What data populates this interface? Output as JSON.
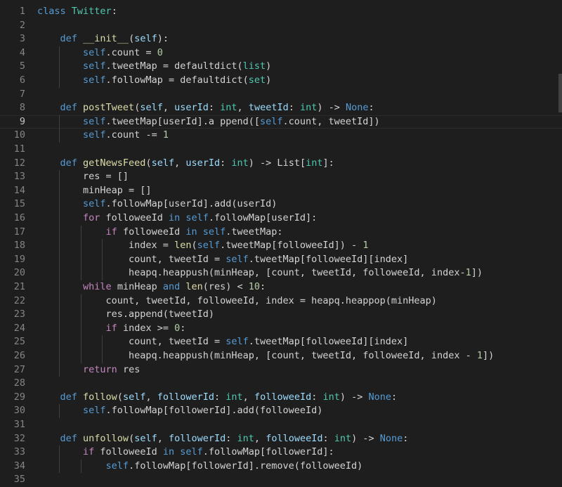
{
  "editor": {
    "colors": {
      "background": "#1e1e1e",
      "line_number": "#858585",
      "keyword": "#569cd6",
      "control": "#c586c0",
      "class": "#4ec9b0",
      "function": "#dcdcaa",
      "param": "#9cdcfe",
      "number": "#b5cea8",
      "text": "#d4d4d4"
    },
    "current_line": 9,
    "lines": [
      [
        [
          "class ",
          "kw"
        ],
        [
          "Twitter",
          "cls"
        ],
        [
          ":",
          "plain"
        ]
      ],
      [],
      [
        [
          "    ",
          "plain"
        ],
        [
          "def ",
          "kw"
        ],
        [
          "__init__",
          "fn"
        ],
        [
          "(",
          "plain"
        ],
        [
          "self",
          "param"
        ],
        [
          "):",
          "plain"
        ]
      ],
      [
        [
          "        ",
          "plain"
        ],
        [
          "self",
          "self"
        ],
        [
          ".count = ",
          "plain"
        ],
        [
          "0",
          "num"
        ]
      ],
      [
        [
          "        ",
          "plain"
        ],
        [
          "self",
          "self"
        ],
        [
          ".tweetMap = defaultdict(",
          "plain"
        ],
        [
          "list",
          "type"
        ],
        [
          ")",
          "plain"
        ]
      ],
      [
        [
          "        ",
          "plain"
        ],
        [
          "self",
          "self"
        ],
        [
          ".followMap = defaultdict(",
          "plain"
        ],
        [
          "set",
          "type"
        ],
        [
          ")",
          "plain"
        ]
      ],
      [],
      [
        [
          "    ",
          "plain"
        ],
        [
          "def ",
          "kw"
        ],
        [
          "postTweet",
          "fn"
        ],
        [
          "(",
          "plain"
        ],
        [
          "self",
          "param"
        ],
        [
          ", ",
          "plain"
        ],
        [
          "userId",
          "param"
        ],
        [
          ": ",
          "plain"
        ],
        [
          "int",
          "type"
        ],
        [
          ", ",
          "plain"
        ],
        [
          "tweetId",
          "param"
        ],
        [
          ": ",
          "plain"
        ],
        [
          "int",
          "type"
        ],
        [
          ") -> ",
          "plain"
        ],
        [
          "None",
          "none"
        ],
        [
          ":",
          "plain"
        ]
      ],
      [
        [
          "        ",
          "plain"
        ],
        [
          "self",
          "self"
        ],
        [
          ".tweetMap[userId].a ppend([",
          "plain"
        ],
        [
          "self",
          "self"
        ],
        [
          ".count, tweetId])",
          "plain"
        ]
      ],
      [
        [
          "        ",
          "plain"
        ],
        [
          "self",
          "self"
        ],
        [
          ".count -= ",
          "plain"
        ],
        [
          "1",
          "num"
        ]
      ],
      [],
      [
        [
          "    ",
          "plain"
        ],
        [
          "def ",
          "kw"
        ],
        [
          "getNewsFeed",
          "fn"
        ],
        [
          "(",
          "plain"
        ],
        [
          "self",
          "param"
        ],
        [
          ", ",
          "plain"
        ],
        [
          "userId",
          "param"
        ],
        [
          ": ",
          "plain"
        ],
        [
          "int",
          "type"
        ],
        [
          ") -> List[",
          "plain"
        ],
        [
          "int",
          "type"
        ],
        [
          "]:",
          "plain"
        ]
      ],
      [
        [
          "        res = []",
          "plain"
        ]
      ],
      [
        [
          "        minHeap = []",
          "plain"
        ]
      ],
      [
        [
          "        ",
          "plain"
        ],
        [
          "self",
          "self"
        ],
        [
          ".followMap[userId].add(userId)",
          "plain"
        ]
      ],
      [
        [
          "        ",
          "plain"
        ],
        [
          "for ",
          "ctrl"
        ],
        [
          "followeeId ",
          "plain"
        ],
        [
          "in ",
          "kw"
        ],
        [
          "self",
          "self"
        ],
        [
          ".followMap[userId]:",
          "plain"
        ]
      ],
      [
        [
          "            ",
          "plain"
        ],
        [
          "if ",
          "ctrl"
        ],
        [
          "followeeId ",
          "plain"
        ],
        [
          "in ",
          "kw"
        ],
        [
          "self",
          "self"
        ],
        [
          ".tweetMap:",
          "plain"
        ]
      ],
      [
        [
          "                index = ",
          "plain"
        ],
        [
          "len",
          "fn"
        ],
        [
          "(",
          "plain"
        ],
        [
          "self",
          "self"
        ],
        [
          ".tweetMap[followeeId]) - ",
          "plain"
        ],
        [
          "1",
          "num"
        ]
      ],
      [
        [
          "                count, tweetId = ",
          "plain"
        ],
        [
          "self",
          "self"
        ],
        [
          ".tweetMap[followeeId][index]",
          "plain"
        ]
      ],
      [
        [
          "                heapq.heappush(minHeap, [count, tweetId, followeeId, index-",
          "plain"
        ],
        [
          "1",
          "num"
        ],
        [
          "])",
          "plain"
        ]
      ],
      [
        [
          "        ",
          "plain"
        ],
        [
          "while ",
          "ctrl"
        ],
        [
          "minHeap ",
          "plain"
        ],
        [
          "and ",
          "kw"
        ],
        [
          "len",
          "fn"
        ],
        [
          "(res) < ",
          "plain"
        ],
        [
          "10",
          "num"
        ],
        [
          ":",
          "plain"
        ]
      ],
      [
        [
          "            count, tweetId, followeeId, index = heapq.heappop(minHeap)",
          "plain"
        ]
      ],
      [
        [
          "            res.append(tweetId)",
          "plain"
        ]
      ],
      [
        [
          "            ",
          "plain"
        ],
        [
          "if ",
          "ctrl"
        ],
        [
          "index >= ",
          "plain"
        ],
        [
          "0",
          "num"
        ],
        [
          ":",
          "plain"
        ]
      ],
      [
        [
          "                count, tweetId = ",
          "plain"
        ],
        [
          "self",
          "self"
        ],
        [
          ".tweetMap[followeeId][index]",
          "plain"
        ]
      ],
      [
        [
          "                heapq.heappush(minHeap, [count, tweetId, followeeId, index - ",
          "plain"
        ],
        [
          "1",
          "num"
        ],
        [
          "])",
          "plain"
        ]
      ],
      [
        [
          "        ",
          "plain"
        ],
        [
          "return ",
          "ctrl"
        ],
        [
          "res",
          "plain"
        ]
      ],
      [],
      [
        [
          "    ",
          "plain"
        ],
        [
          "def ",
          "kw"
        ],
        [
          "follow",
          "fn"
        ],
        [
          "(",
          "plain"
        ],
        [
          "self",
          "param"
        ],
        [
          ", ",
          "plain"
        ],
        [
          "followerId",
          "param"
        ],
        [
          ": ",
          "plain"
        ],
        [
          "int",
          "type"
        ],
        [
          ", ",
          "plain"
        ],
        [
          "followeeId",
          "param"
        ],
        [
          ": ",
          "plain"
        ],
        [
          "int",
          "type"
        ],
        [
          ") -> ",
          "plain"
        ],
        [
          "None",
          "none"
        ],
        [
          ":",
          "plain"
        ]
      ],
      [
        [
          "        ",
          "plain"
        ],
        [
          "self",
          "self"
        ],
        [
          ".followMap[followerId].add(followeeId)",
          "plain"
        ]
      ],
      [],
      [
        [
          "    ",
          "plain"
        ],
        [
          "def ",
          "kw"
        ],
        [
          "unfollow",
          "fn"
        ],
        [
          "(",
          "plain"
        ],
        [
          "self",
          "param"
        ],
        [
          ", ",
          "plain"
        ],
        [
          "followerId",
          "param"
        ],
        [
          ": ",
          "plain"
        ],
        [
          "int",
          "type"
        ],
        [
          ", ",
          "plain"
        ],
        [
          "followeeId",
          "param"
        ],
        [
          ": ",
          "plain"
        ],
        [
          "int",
          "type"
        ],
        [
          ") -> ",
          "plain"
        ],
        [
          "None",
          "none"
        ],
        [
          ":",
          "plain"
        ]
      ],
      [
        [
          "        ",
          "plain"
        ],
        [
          "if ",
          "ctrl"
        ],
        [
          "followeeId ",
          "plain"
        ],
        [
          "in ",
          "kw"
        ],
        [
          "self",
          "self"
        ],
        [
          ".followMap[followerId]:",
          "plain"
        ]
      ],
      [
        [
          "            ",
          "plain"
        ],
        [
          "self",
          "self"
        ],
        [
          ".followMap[followerId].remove(followeeId)",
          "plain"
        ]
      ],
      []
    ]
  }
}
